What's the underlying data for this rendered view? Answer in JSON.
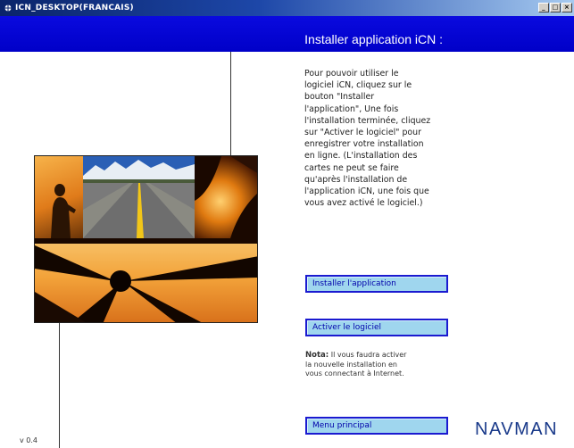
{
  "window": {
    "title": "ICN_DESKTOP(FRANCAIS)",
    "controls": [
      "_",
      "□",
      "×"
    ]
  },
  "header": {
    "title": "Installer application iCN :",
    "background_color": "#0000cc"
  },
  "info_text": [
    "Pour pouvoir utiliser le",
    "logiciel iCN, cliquez sur le",
    "bouton \"Installer",
    "l'application\", Une fois",
    "l'installation terminée, cliquez",
    "sur \"Activer le logiciel\" pour",
    "enregistrer votre installation",
    "en ligne. (L'installation des",
    "cartes ne peut se faire",
    "qu'après l'installation de",
    "l'application iCN, une fois que",
    "vous avez activé le logiciel.)"
  ],
  "buttons": {
    "install_label": "Installer l'application",
    "activate_label": "Activer le logiciel",
    "menu_label": "Menu principal",
    "button_bg_color": "#9fd6ee",
    "button_border_color": "#1a1ad0"
  },
  "note": {
    "label": "Nota:",
    "line1": "Il vous faudra activer",
    "line2": "la nouvelle installation en",
    "line3": "vous connectant à Internet."
  },
  "footer": {
    "version": "v 0.4",
    "brand": "NAVMAN"
  },
  "icons": {
    "app": "window-app-icon",
    "minimize": "minimize-icon",
    "maximize": "maximize-icon",
    "close": "close-icon"
  }
}
